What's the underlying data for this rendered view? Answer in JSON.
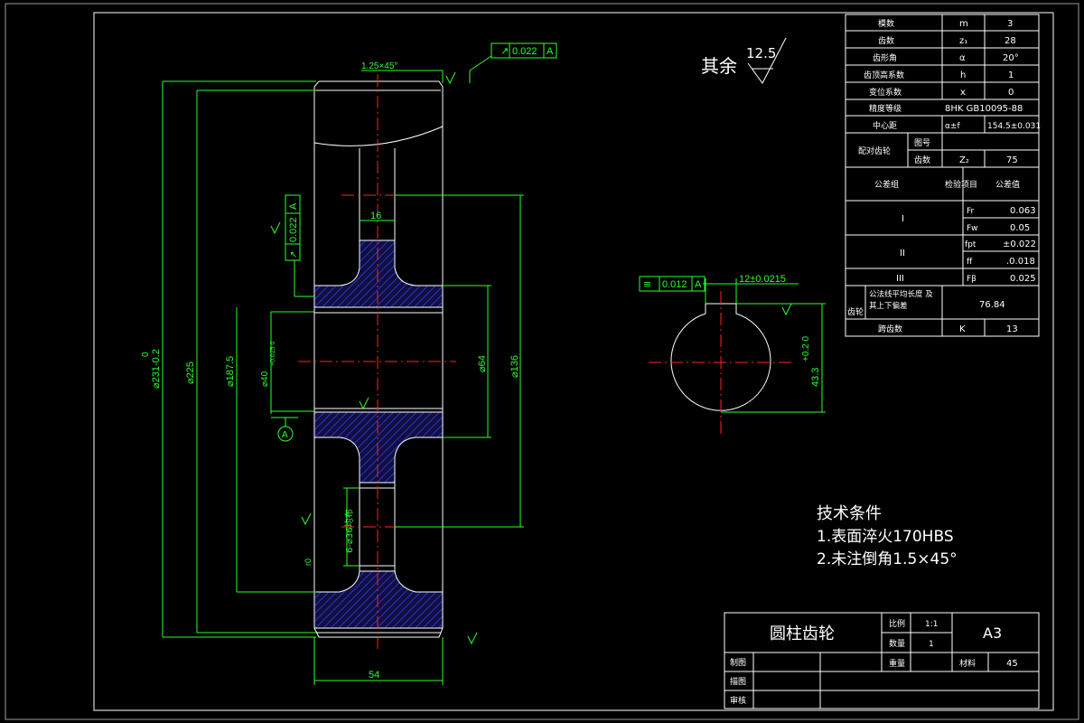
{
  "drawing": {
    "dims": {
      "chamfer": "1.25×45°",
      "runout_top": "0.022",
      "datum": "A",
      "runout_side": "0.022",
      "web_width": "16",
      "od_tol_upper": "0",
      "od": "⌀231-0.2",
      "d225": "⌀225",
      "d1875": "⌀187.5",
      "bore": "⌀40",
      "bore_tol": "+0.025 0",
      "d64": "⌀64",
      "d136": "⌀136",
      "holes": "6-⌀36均布",
      "face_width": "54",
      "r_label": "r0"
    },
    "rough_default_label": "其余",
    "rough_default_value": "12.5",
    "keyway": {
      "symmetry": "0.012",
      "datum": "A",
      "width": "12±0.0215",
      "depth": "43.3",
      "depth_tol": "+0.2 0"
    },
    "table": {
      "rows": [
        {
          "label": "模数",
          "sym": "m",
          "val": "3"
        },
        {
          "label": "齿数",
          "sym": "z₁",
          "val": "28"
        },
        {
          "label": "齿形角",
          "sym": "α",
          "val": "20°"
        },
        {
          "label": "齿顶高系数",
          "sym": "h",
          "val": "1"
        },
        {
          "label": "变位系数",
          "sym": "x",
          "val": "0"
        },
        {
          "label": "精度等级",
          "span": "8HK GB10095-88"
        },
        {
          "label": "中心距",
          "sym": "α±f",
          "val": "154.5±0.031"
        }
      ],
      "mating_label": "配对齿轮",
      "mating_rows": [
        {
          "label": "图号",
          "sym": "",
          "val": ""
        },
        {
          "label": "齿数",
          "sym": "Z₂",
          "val": "75"
        }
      ],
      "group_header": "公差组",
      "item_header": "检验项目",
      "tol_header": "公差值",
      "groups": [
        {
          "name": "I",
          "items": [
            {
              "sym": "Fr",
              "val": "0.063"
            },
            {
              "sym": "Fw",
              "val": "0.05"
            }
          ]
        },
        {
          "name": "II",
          "items": [
            {
              "sym": "fpt",
              "val": "±0.022"
            },
            {
              "sym": "ff",
              "val": ".0.018"
            }
          ]
        },
        {
          "name": "III",
          "items": [
            {
              "sym": "Fβ",
              "val": "0.025"
            }
          ]
        }
      ],
      "tooth_label": "齿轮",
      "common_normal_label": "公法线平均长度 及其上下偏差",
      "common_normal_val": "76.84",
      "span_label": "跨齿数",
      "span_sym": "K",
      "span_val": "13"
    },
    "notes": {
      "title": "技术条件",
      "line1": "1.表面淬火170HBS",
      "line2": "2.未注倒角1.5×45°"
    },
    "title_block": {
      "part_name": "圆柱齿轮",
      "scale_label": "比例",
      "scale_val": "1:1",
      "qty_label": "数量",
      "qty_val": "1",
      "weight_label": "重量",
      "material_label": "材料",
      "material_val": "45",
      "sheet": "A3",
      "drawn_label": "制图",
      "design_label": "描图",
      "check_label": "审核"
    }
  }
}
